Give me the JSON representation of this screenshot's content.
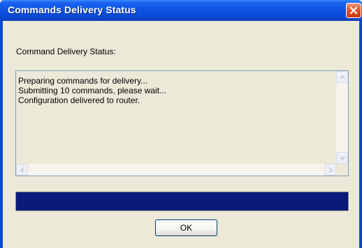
{
  "window": {
    "title": "Commands Delivery Status"
  },
  "dialog": {
    "status_label": "Command Delivery Status:",
    "log_lines": [
      "Preparing commands for delivery...",
      "Submitting 10 commands, please wait...",
      "Configuration delivered to router."
    ],
    "progress_fraction": 1.0,
    "ok_label": "OK"
  },
  "colors": {
    "titlebar": "#0c52e0",
    "close_button": "#e0592f",
    "progress_fill": "#0a1a7a",
    "dialog_background": "#ece9d8"
  },
  "icons": {
    "close": "close-icon",
    "scroll_up": "arrow-up-icon",
    "scroll_down": "arrow-down-icon",
    "scroll_left": "arrow-left-icon",
    "scroll_right": "arrow-right-icon"
  }
}
